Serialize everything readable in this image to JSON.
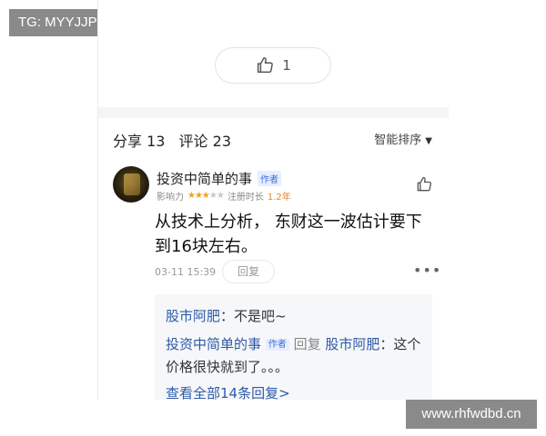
{
  "tag_top_left": "TG: MYYJJPP",
  "like_pill": {
    "count": "1",
    "icon": "thumb-up-icon"
  },
  "stats": {
    "share": "分享 13",
    "comment": "评论 23"
  },
  "sort": {
    "label": "智能排序",
    "icon": "caret-down-icon"
  },
  "comment": {
    "author": "投资中简单的事",
    "author_badge": "作者",
    "influence_label": "影响力",
    "stars": {
      "filled": 3,
      "total": 5
    },
    "register_label": "注册时长",
    "register_value": "1.2年",
    "text": "从技术上分析， 东财这一波估计要下到16块左右。",
    "time": "03-11 15:39",
    "reply_label": "回复",
    "more_label": "•••"
  },
  "replies": {
    "r1_name": "股市阿肥",
    "r1_text": "：不是吧~",
    "r2_name": "投资中简单的事",
    "r2_badge": "作者",
    "r2_mid": "回复",
    "r2_target": "股市阿肥",
    "r2_text": "：这个价格很快就到了。。。",
    "view_all": "查看全部14条回复>"
  },
  "watermark": "www.rhfwdbd.cn",
  "colors": {
    "link_blue": "#2d5aa8",
    "star": "#f0a020",
    "badge_bg": "#e6eeff",
    "badge_text": "#3f6fd8"
  }
}
